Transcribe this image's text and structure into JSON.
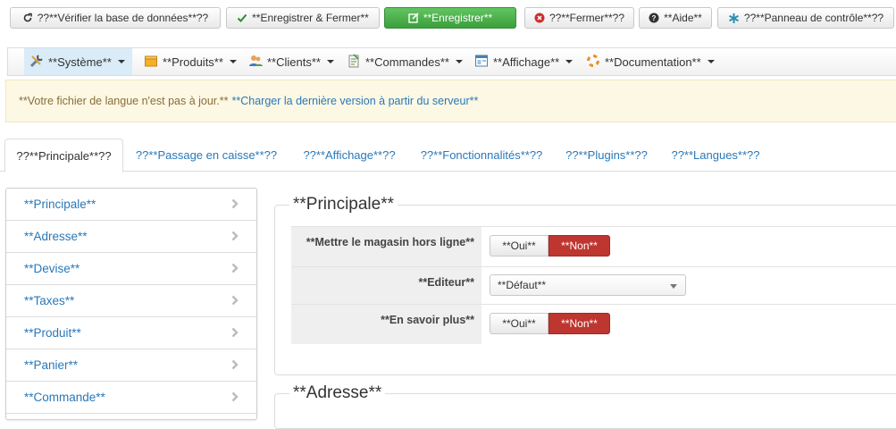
{
  "toolbar": {
    "check_db": "??**Vérifier la base de données**??",
    "save_close": "**Enregistrer & Fermer**",
    "save": "**Enregistrer**",
    "close": "??**Fermer**??",
    "help": "**Aide**",
    "control_panel": "??**Panneau de contrôle**??"
  },
  "menu": {
    "items": [
      {
        "label": "**Système**",
        "icon": "tools-icon"
      },
      {
        "label": "**Produits**",
        "icon": "box-icon"
      },
      {
        "label": "**Clients**",
        "icon": "users-icon"
      },
      {
        "label": "**Commandes**",
        "icon": "clipboard-icon"
      },
      {
        "label": "**Affichage**",
        "icon": "window-icon"
      },
      {
        "label": "**Documentation**",
        "icon": "lifebuoy-icon"
      }
    ]
  },
  "alert": {
    "text": "**Votre fichier de langue n'est pas à jour.**",
    "link": "**Charger la dernière version à partir du serveur**"
  },
  "tabs": [
    {
      "label": "??**Principale**??"
    },
    {
      "label": "??**Passage en caisse**??"
    },
    {
      "label": "??**Affichage**??"
    },
    {
      "label": "??**Fonctionnalités**??"
    },
    {
      "label": "??**Plugins**??"
    },
    {
      "label": "??**Langues**??"
    }
  ],
  "sidenav": {
    "items": [
      {
        "label": "**Principale**"
      },
      {
        "label": "**Adresse**"
      },
      {
        "label": "**Devise**"
      },
      {
        "label": "**Taxes**"
      },
      {
        "label": "**Produit**"
      },
      {
        "label": "**Panier**"
      },
      {
        "label": "**Commande**"
      }
    ]
  },
  "sections": {
    "principale": {
      "title": "**Principale**",
      "rows": [
        {
          "label": "**Mettre le magasin hors ligne**",
          "oui": "**Oui**",
          "non": "**Non**"
        },
        {
          "label": "**Editeur**",
          "value": "**Défaut**"
        },
        {
          "label": "**En savoir plus**",
          "oui": "**Oui**",
          "non": "**Non**"
        }
      ]
    },
    "adresse": {
      "title": "**Adresse**"
    }
  },
  "colors": {
    "link": "#2a78b8",
    "success": "#51a351",
    "danger": "#bd362f",
    "alert_bg": "#fcf8e3"
  }
}
